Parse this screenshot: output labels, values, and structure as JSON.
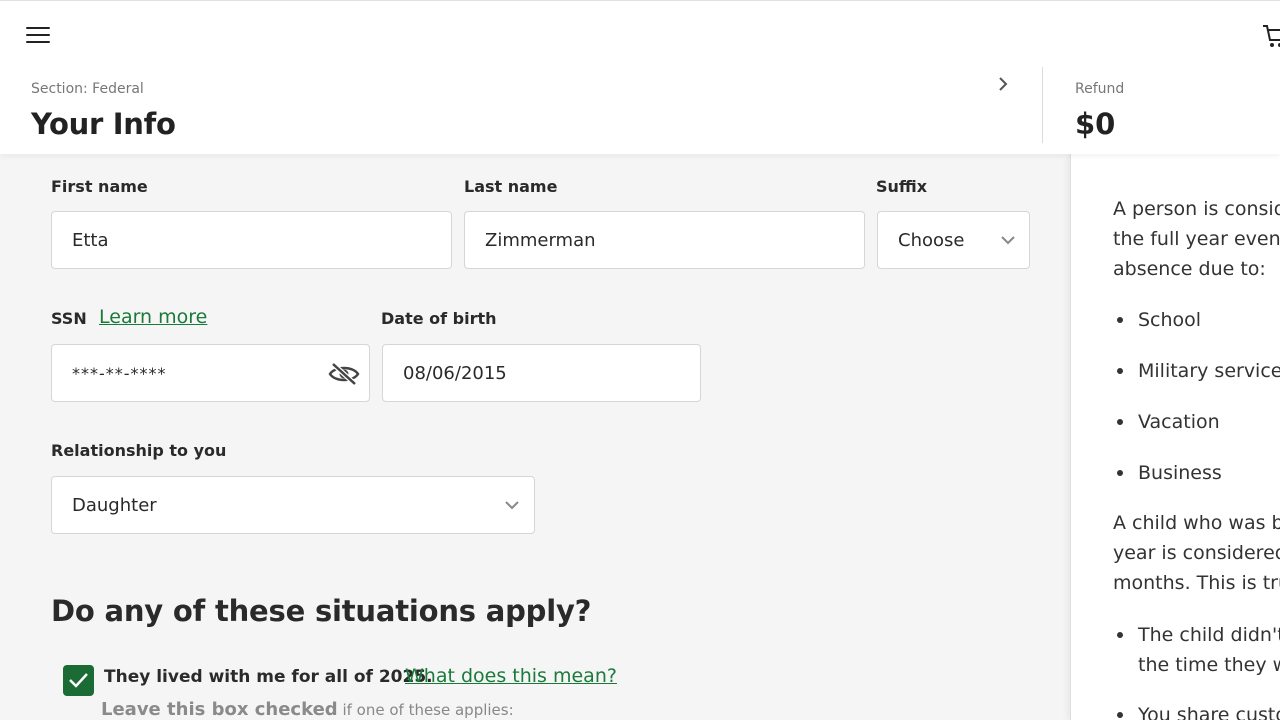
{
  "header": {
    "section_label": "Section: Federal",
    "title": "Your Info",
    "refund_label": "Refund",
    "refund_amount": "$0"
  },
  "form": {
    "first_name": {
      "label": "First name",
      "value": "Etta"
    },
    "last_name": {
      "label": "Last name",
      "value": "Zimmerman"
    },
    "suffix": {
      "label": "Suffix",
      "value": "Choose"
    },
    "ssn": {
      "label": "SSN",
      "learn_more": "Learn more",
      "value": "***-**-****"
    },
    "dob": {
      "label": "Date of birth",
      "value": "08/06/2015"
    },
    "relationship": {
      "label": "Relationship to you",
      "value": "Daughter"
    },
    "situations_heading": "Do any of these situations apply?",
    "lived_with": {
      "checked": true,
      "label": "They lived with me for all of 2025.",
      "link": "What does this mean?",
      "hint_bold": "Leave this box checked",
      "hint_rest": " if one of these applies:"
    }
  },
  "side_panel": {
    "para1": [
      "A person is consid",
      "the full year even i",
      "absence due to:"
    ],
    "bullets": [
      "School",
      "Military service",
      "Vacation",
      "Business"
    ],
    "para2": [
      "A child who was b",
      "year is considered",
      "months. This is tru"
    ],
    "bullets2": [
      "The child didn't",
      "the time they w",
      "You share custo"
    ]
  },
  "colors": {
    "accent_green": "#1a7a3a",
    "checkbox_green": "#1b6b35"
  },
  "icons": [
    "menu-icon",
    "cart-icon",
    "chevron-right-icon",
    "eye-slash-icon",
    "chevron-down-icon",
    "checkmark-icon"
  ]
}
